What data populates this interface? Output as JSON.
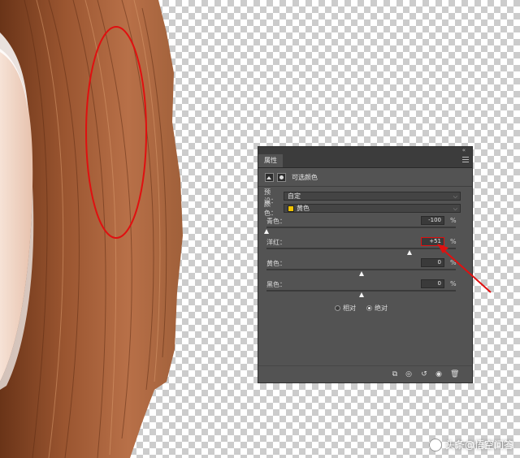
{
  "panel": {
    "tab_label": "属性",
    "collapse_glyph": "«",
    "title": "可选颜色",
    "preset": {
      "label": "预设：",
      "value": "自定"
    },
    "colors": {
      "label": "颜色：",
      "value": "黄色",
      "swatch": "#f2c400"
    },
    "sliders": [
      {
        "label": "青色：",
        "value": "-100",
        "unit": "%",
        "level": 0.0
      },
      {
        "label": "洋红：",
        "value": "+51",
        "unit": "%",
        "level": 0.755
      },
      {
        "label": "黄色：",
        "value": "0",
        "unit": "%",
        "level": 0.5
      },
      {
        "label": "黑色：",
        "value": "0",
        "unit": "%",
        "level": 0.5
      }
    ],
    "method": {
      "relative": "相对",
      "absolute": "绝对",
      "selected": "absolute"
    },
    "footer_icons": [
      "clip-to-layer-icon",
      "view-previous-icon",
      "reset-icon",
      "visibility-icon",
      "trash-icon"
    ]
  },
  "annotations": {
    "ellipse_color": "#e01010",
    "arrow_color": "#e01010"
  },
  "watermark": {
    "text": "头条@悟空问答"
  }
}
